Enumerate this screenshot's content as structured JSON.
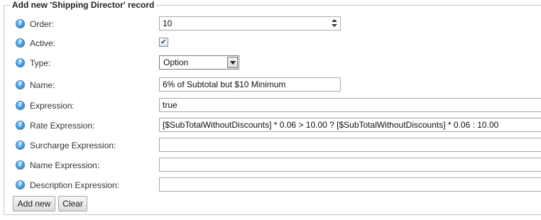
{
  "form": {
    "legend": "Add new 'Shipping Director' record",
    "help_glyph": "?",
    "fields": {
      "order": {
        "label": "Order:",
        "value": "10"
      },
      "active": {
        "label": "Active:",
        "checked": true,
        "check_glyph": "✔"
      },
      "type": {
        "label": "Type:",
        "value": "Option"
      },
      "name": {
        "label": "Name:",
        "value": "6% of Subtotal but $10 Minimum"
      },
      "expression": {
        "label": "Expression:",
        "value": "true"
      },
      "rate_expression": {
        "label": "Rate Expression:",
        "value": "[$SubTotalWithoutDiscounts] * 0.06 > 10.00 ?  [$SubTotalWithoutDiscounts] * 0.06 : 10.00"
      },
      "surcharge_expression": {
        "label": "Surcharge Expression:",
        "value": ""
      },
      "name_expression": {
        "label": "Name Expression:",
        "value": ""
      },
      "description_expression": {
        "label": "Description Expression:",
        "value": ""
      }
    },
    "buttons": {
      "add_new": "Add new",
      "clear": "Clear"
    }
  },
  "colors": {
    "help_icon": "#4a9be0",
    "border": "#a9a9a9",
    "button_bg": "#e6e6e6"
  },
  "icons": {
    "help": "help-icon",
    "checkbox": "check-icon",
    "select": "chevron-down-icon",
    "spinner": "spinner-arrows-icon"
  }
}
